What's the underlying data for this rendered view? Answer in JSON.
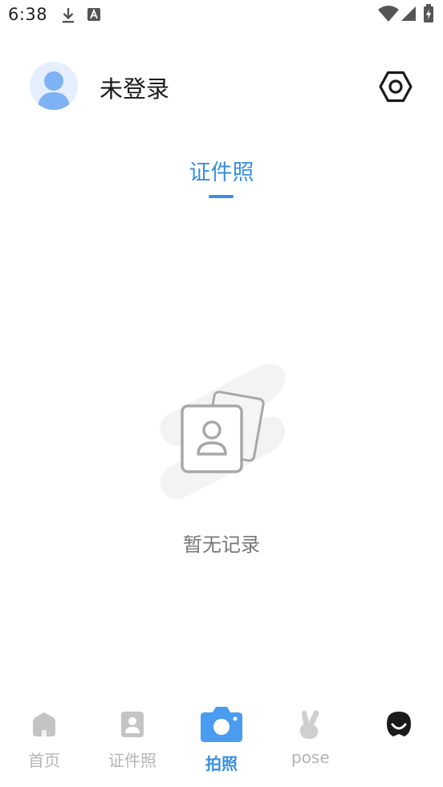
{
  "status_bar": {
    "time": "6:38",
    "icons": [
      "download-icon",
      "a-notification-icon",
      "wifi-icon",
      "signal-icon",
      "battery-charging-icon"
    ]
  },
  "header": {
    "username": "未登录",
    "settings_icon": "settings-hexagon-icon"
  },
  "tabs": [
    {
      "label": "证件照",
      "active": true
    }
  ],
  "empty_state": {
    "message": "暂无记录",
    "icon": "id-photo-cards-icon"
  },
  "bottom_nav": {
    "items": [
      {
        "label": "首页",
        "icon": "home-icon",
        "active": false
      },
      {
        "label": "证件照",
        "icon": "id-photo-icon",
        "active": false
      },
      {
        "label": "拍照",
        "icon": "camera-icon",
        "active": true
      },
      {
        "label": "pose",
        "icon": "victory-hand-icon",
        "active": false
      },
      {
        "label": "",
        "icon": "profile-face-icon",
        "active": false
      }
    ]
  },
  "colors": {
    "accent": "#3a8fe0",
    "camera_active": "#4a9cf0",
    "inactive": "#b5b5b5",
    "background": "#ffffff"
  }
}
